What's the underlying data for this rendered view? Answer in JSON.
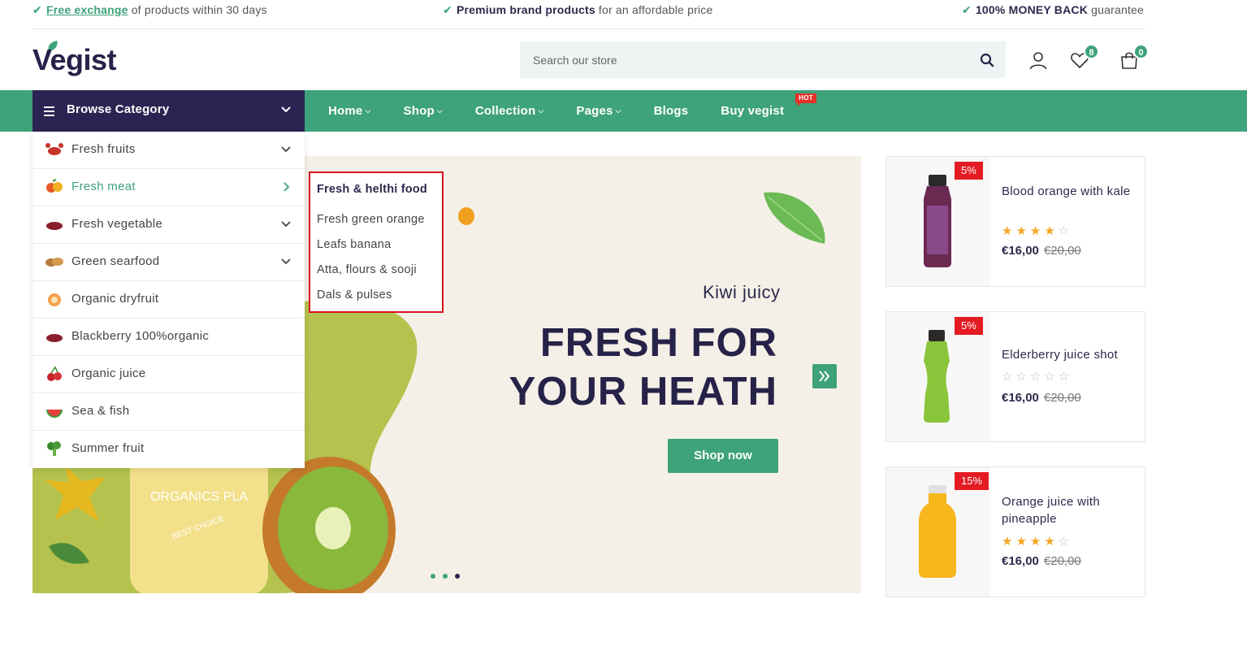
{
  "topbar": {
    "left_link": "Free exchange",
    "left_text": "of products within 30 days",
    "center_bold": "Premium brand products",
    "center_text": "for an affordable price",
    "right_bold": "100% MONEY BACK",
    "right_text": "guarantee"
  },
  "brand": {
    "logo": "Vegist"
  },
  "search": {
    "placeholder": "Search our store"
  },
  "header": {
    "wishlist_count": "8",
    "cart_count": "0"
  },
  "browse": {
    "label": "Browse Category"
  },
  "nav": {
    "items": [
      "Home",
      "Shop",
      "Collection",
      "Pages",
      "Blogs",
      "Buy vegist"
    ],
    "hot_badge": "HOT"
  },
  "categories": [
    "Fresh fruits",
    "Fresh meat",
    "Fresh vegetable",
    "Green searfood",
    "Organic dryfruit",
    "Blackberry 100%organic",
    "Organic juice",
    "Sea & fish",
    "Summer fruit"
  ],
  "submenu": {
    "heading": "Fresh & helthi food",
    "items": [
      "Fresh green orange",
      "Leafs banana",
      "Atta, flours & sooji",
      "Dals & pulses"
    ]
  },
  "banner": {
    "subtitle": "Kiwi juicy",
    "title_line1": "FRESH FOR",
    "title_line2": "YOUR HEATH",
    "button": "Shop now",
    "bottle_text": "ORGANICS PLA",
    "bottle_sub": "BEST CHOICE"
  },
  "products": [
    {
      "name": "Blood orange with kale",
      "discount": "5%",
      "price": "€16,00",
      "old_price": "€20,00",
      "rating": 4
    },
    {
      "name": "Elderberry juice shot",
      "discount": "5%",
      "price": "€16,00",
      "old_price": "€20,00",
      "rating": 0
    },
    {
      "name": "Orange juice with pineapple",
      "discount": "15%",
      "price": "€16,00",
      "old_price": "€20,00",
      "rating": 4
    }
  ],
  "colors": {
    "accent": "#3ea27a",
    "navy": "#2b2452",
    "sale": "#e41b23"
  }
}
